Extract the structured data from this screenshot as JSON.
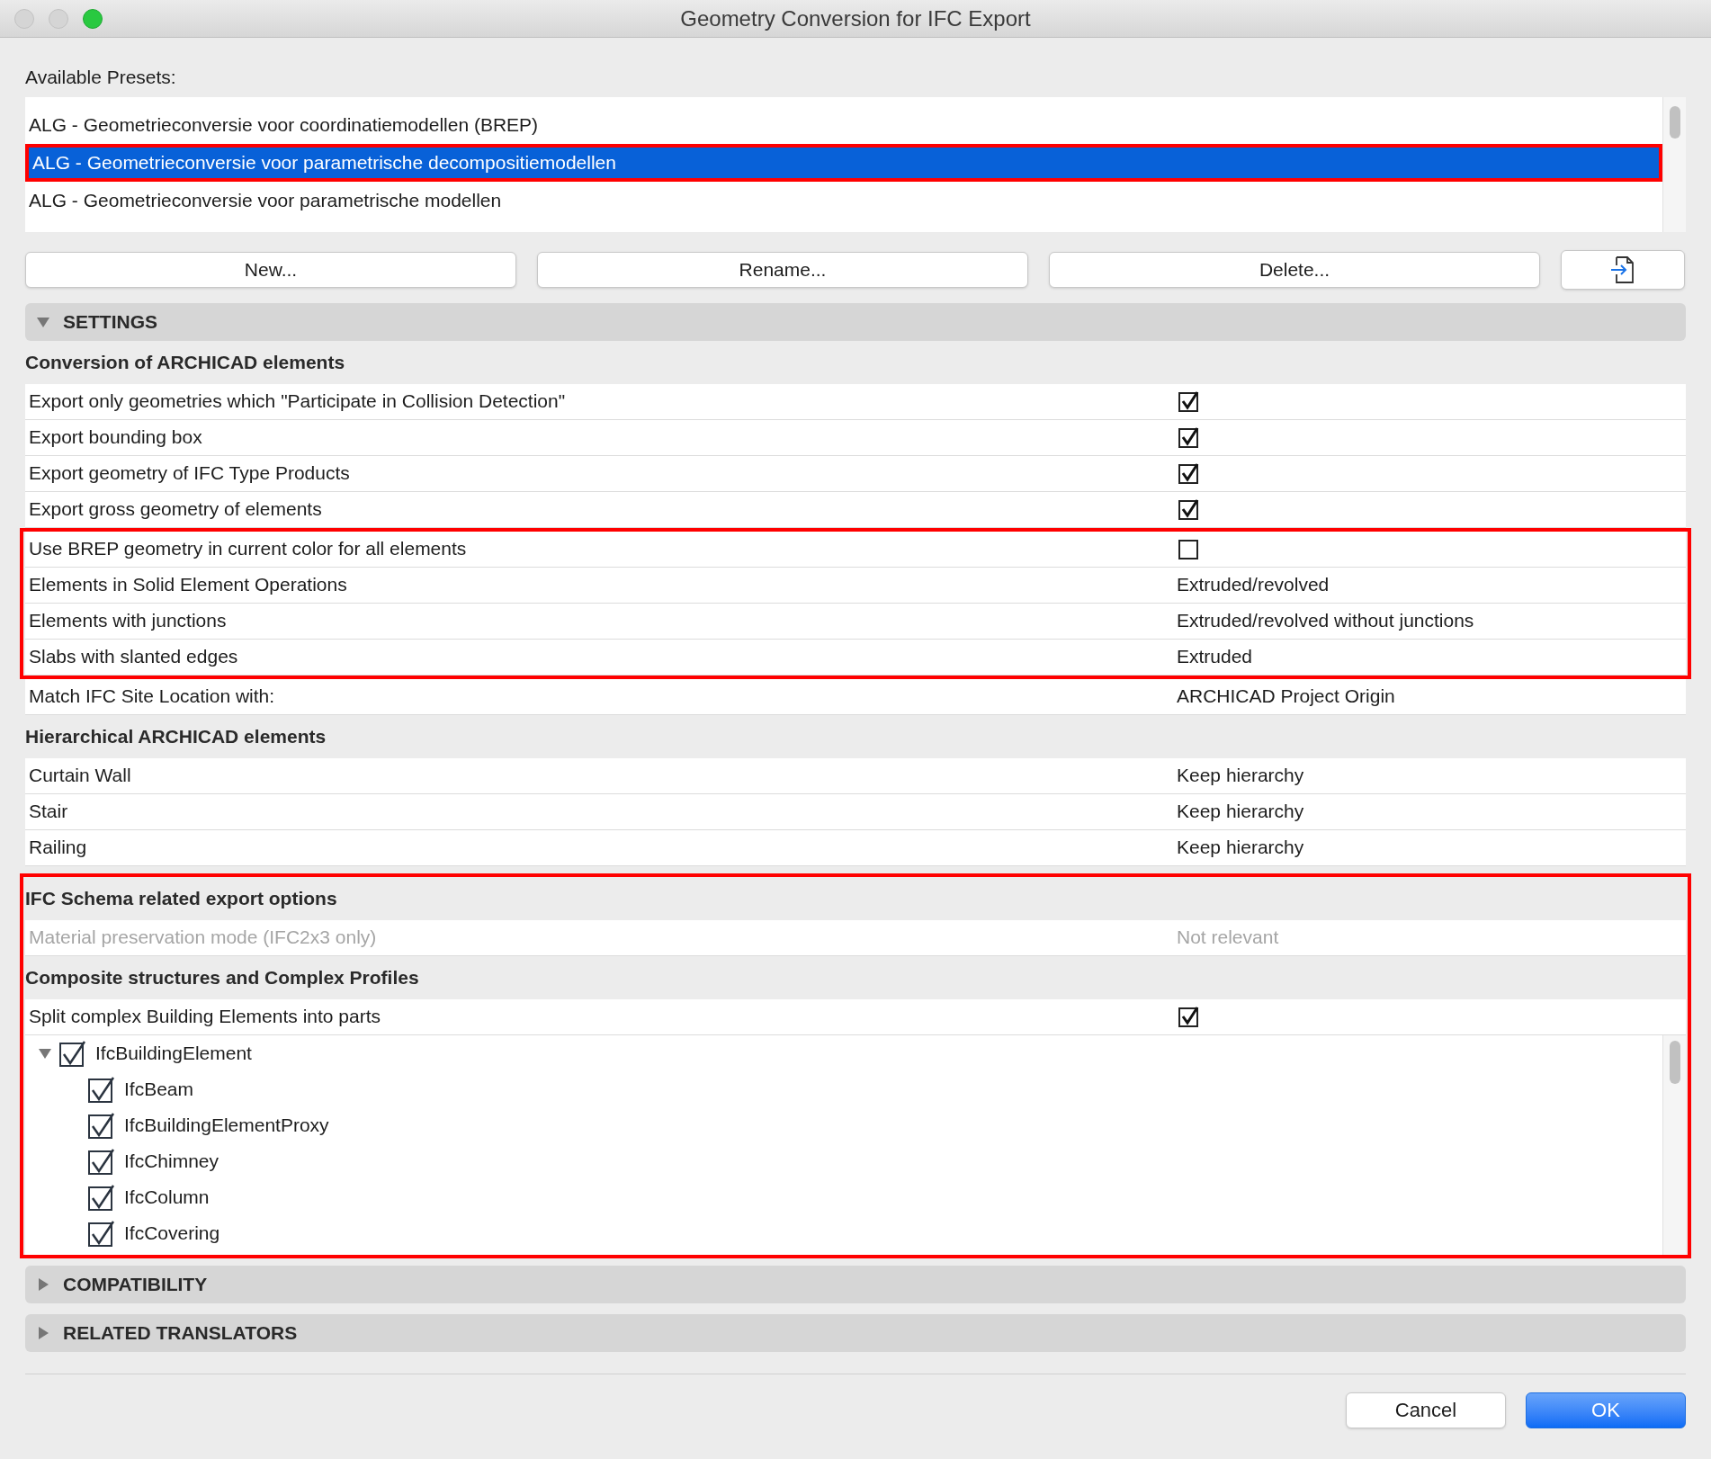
{
  "window": {
    "title": "Geometry Conversion for IFC Export"
  },
  "presets": {
    "label": "Available Presets:",
    "items": [
      {
        "label": "ALG - Geometrieconversie voor coordinatiemodellen (BREP)",
        "selected": false,
        "outlined": false
      },
      {
        "label": "ALG - Geometrieconversie voor parametrische decompositiemodellen",
        "selected": true,
        "outlined": true
      },
      {
        "label": "ALG - Geometrieconversie voor parametrische modellen",
        "selected": false,
        "outlined": false
      }
    ]
  },
  "preset_buttons": [
    "New...",
    "Rename...",
    "Delete..."
  ],
  "settings_panel": {
    "title": "SETTINGS",
    "expanded": true
  },
  "blocks": [
    {
      "outlined": false,
      "sections": [
        {
          "title": "Conversion of ARCHICAD elements",
          "groups": [
            {
              "outlined": false,
              "rows": [
                {
                  "kind": "checkbox",
                  "label": "Export only geometries which \"Participate in Collision Detection\"",
                  "checked": true
                },
                {
                  "kind": "checkbox",
                  "label": "Export bounding box",
                  "checked": true
                },
                {
                  "kind": "checkbox",
                  "label": "Export geometry of IFC Type Products",
                  "checked": true
                },
                {
                  "kind": "checkbox",
                  "label": "Export gross geometry of elements",
                  "checked": true
                }
              ]
            },
            {
              "outlined": true,
              "rows": [
                {
                  "kind": "checkbox",
                  "label": "Use BREP geometry in current color for all elements",
                  "checked": false
                },
                {
                  "kind": "value",
                  "label": "Elements in Solid Element Operations",
                  "value": "Extruded/revolved",
                  "disabled": false
                },
                {
                  "kind": "value",
                  "label": "Elements with junctions",
                  "value": "Extruded/revolved without junctions",
                  "disabled": false
                },
                {
                  "kind": "value",
                  "label": "Slabs with slanted edges",
                  "value": "Extruded",
                  "disabled": false
                }
              ]
            },
            {
              "outlined": false,
              "rows": [
                {
                  "kind": "value",
                  "label": "Match IFC Site Location with:",
                  "value": "ARCHICAD Project Origin",
                  "disabled": false
                }
              ]
            }
          ]
        },
        {
          "title": "Hierarchical ARCHICAD elements",
          "groups": [
            {
              "outlined": false,
              "rows": [
                {
                  "kind": "value",
                  "label": "Curtain Wall",
                  "value": "Keep hierarchy",
                  "disabled": false
                },
                {
                  "kind": "value",
                  "label": "Stair",
                  "value": "Keep hierarchy",
                  "disabled": false
                },
                {
                  "kind": "value",
                  "label": "Railing",
                  "value": "Keep hierarchy",
                  "disabled": false
                }
              ]
            }
          ]
        }
      ]
    },
    {
      "outlined": true,
      "sections": [
        {
          "title": "IFC Schema related export options",
          "groups": [
            {
              "outlined": false,
              "rows": [
                {
                  "kind": "value",
                  "label": "Material preservation mode (IFC2x3 only)",
                  "value": "Not relevant",
                  "disabled": true
                }
              ]
            }
          ]
        },
        {
          "title": "Composite structures and Complex Profiles",
          "groups": [
            {
              "outlined": false,
              "rows": [
                {
                  "kind": "checkbox",
                  "label": "Split complex Building Elements into parts",
                  "checked": true
                }
              ]
            }
          ],
          "tree": [
            {
              "label": "IfcBuildingElement",
              "checked": true,
              "expanded": true,
              "children": [
                {
                  "label": "IfcBeam",
                  "checked": true
                },
                {
                  "label": "IfcBuildingElementProxy",
                  "checked": true
                },
                {
                  "label": "IfcChimney",
                  "checked": true
                },
                {
                  "label": "IfcColumn",
                  "checked": true
                },
                {
                  "label": "IfcCovering",
                  "checked": true
                }
              ]
            }
          ]
        }
      ]
    }
  ],
  "collapsed_panels": [
    {
      "title": "COMPATIBILITY",
      "expanded": false
    },
    {
      "title": "RELATED TRANSLATORS",
      "expanded": false
    }
  ],
  "dialog_buttons": [
    {
      "label": "Cancel",
      "kind": "secondary"
    },
    {
      "label": "OK",
      "kind": "primary"
    }
  ]
}
